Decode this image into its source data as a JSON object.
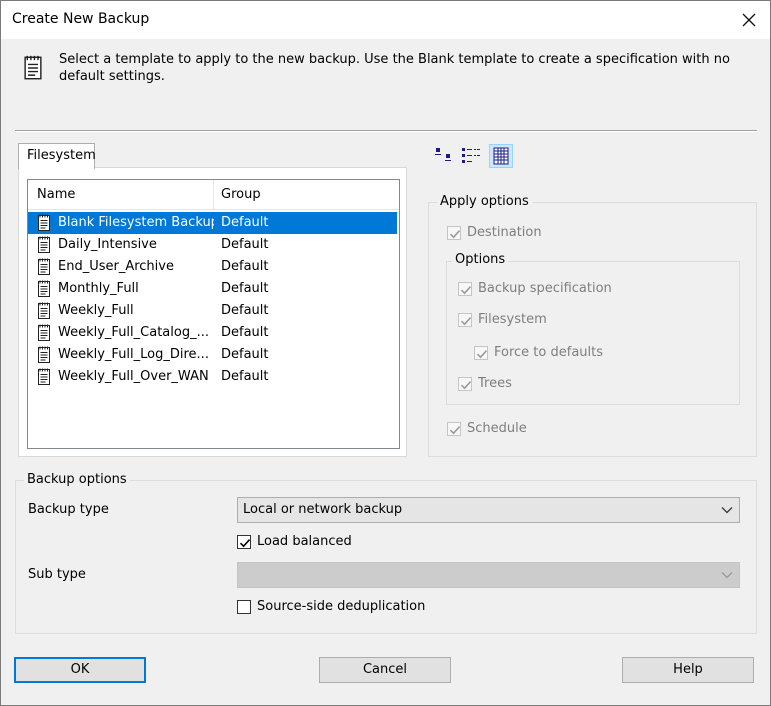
{
  "window": {
    "title": "Create New Backup"
  },
  "header": {
    "description": "Select a template to apply to the new backup. Use the Blank template to create a specification with no default settings."
  },
  "tabs": [
    {
      "label": "Filesystem"
    }
  ],
  "template_list": {
    "columns": [
      "Name",
      "Group"
    ],
    "rows": [
      {
        "name": "Blank Filesystem Backup",
        "group": "Default",
        "selected": true
      },
      {
        "name": "Daily_Intensive",
        "group": "Default"
      },
      {
        "name": "End_User_Archive",
        "group": "Default"
      },
      {
        "name": "Monthly_Full",
        "group": "Default"
      },
      {
        "name": "Weekly_Full",
        "group": "Default"
      },
      {
        "name": "Weekly_Full_Catalog_...",
        "group": "Default"
      },
      {
        "name": "Weekly_Full_Log_Dire...",
        "group": "Default"
      },
      {
        "name": "Weekly_Full_Over_WAN",
        "group": "Default"
      }
    ]
  },
  "view_icons": [
    "small-icons-view-icon",
    "list-view-icon",
    "details-view-icon"
  ],
  "apply_options": {
    "legend": "Apply options",
    "destination": "Destination",
    "options_legend": "Options",
    "backup_specification": "Backup specification",
    "filesystem": "Filesystem",
    "force_to_defaults": "Force to defaults",
    "trees": "Trees",
    "schedule": "Schedule"
  },
  "backup_options": {
    "legend": "Backup options",
    "backup_type_label": "Backup type",
    "backup_type_value": "Local or network backup",
    "load_balanced": "Load balanced",
    "load_balanced_checked": true,
    "sub_type_label": "Sub type",
    "sub_type_value": "",
    "source_side_dedup": "Source-side deduplication",
    "source_side_dedup_checked": false
  },
  "buttons": {
    "ok": "OK",
    "cancel": "Cancel",
    "help": "Help"
  },
  "colors": {
    "selection": "#0078d7",
    "default_button_border": "#0078d7",
    "dialog_bg": "#f0f0f0"
  }
}
